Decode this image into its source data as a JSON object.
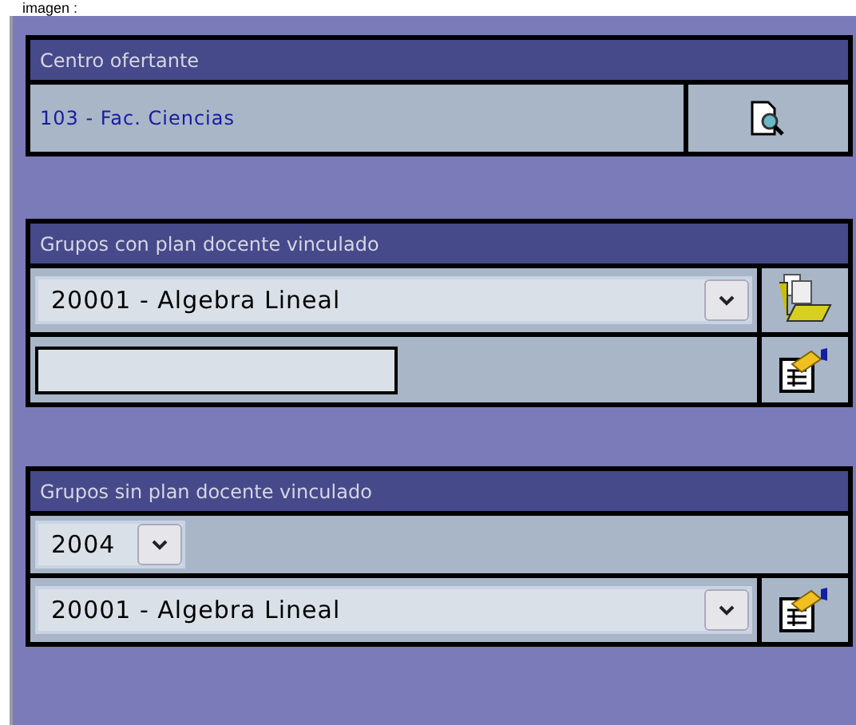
{
  "caption": "imagen :",
  "sections": [
    {
      "title": "Centro ofertante",
      "rows": [
        {
          "kind": "text",
          "value": "103 - Fac. Ciencias",
          "action": {
            "kind": "search"
          }
        }
      ]
    },
    {
      "title": "Grupos con plan docente vinculado",
      "rows": [
        {
          "kind": "select",
          "value": "20001 - Algebra Lineal",
          "action": {
            "kind": "folder"
          }
        },
        {
          "kind": "input",
          "action": {
            "kind": "edit"
          }
        }
      ]
    },
    {
      "title": "Grupos sin plan docente vinculado",
      "rows": [
        {
          "kind": "select",
          "value": "2004"
        },
        {
          "kind": "select",
          "value": "20001 - Algebra Lineal",
          "action": {
            "kind": "edit"
          }
        }
      ]
    }
  ]
}
